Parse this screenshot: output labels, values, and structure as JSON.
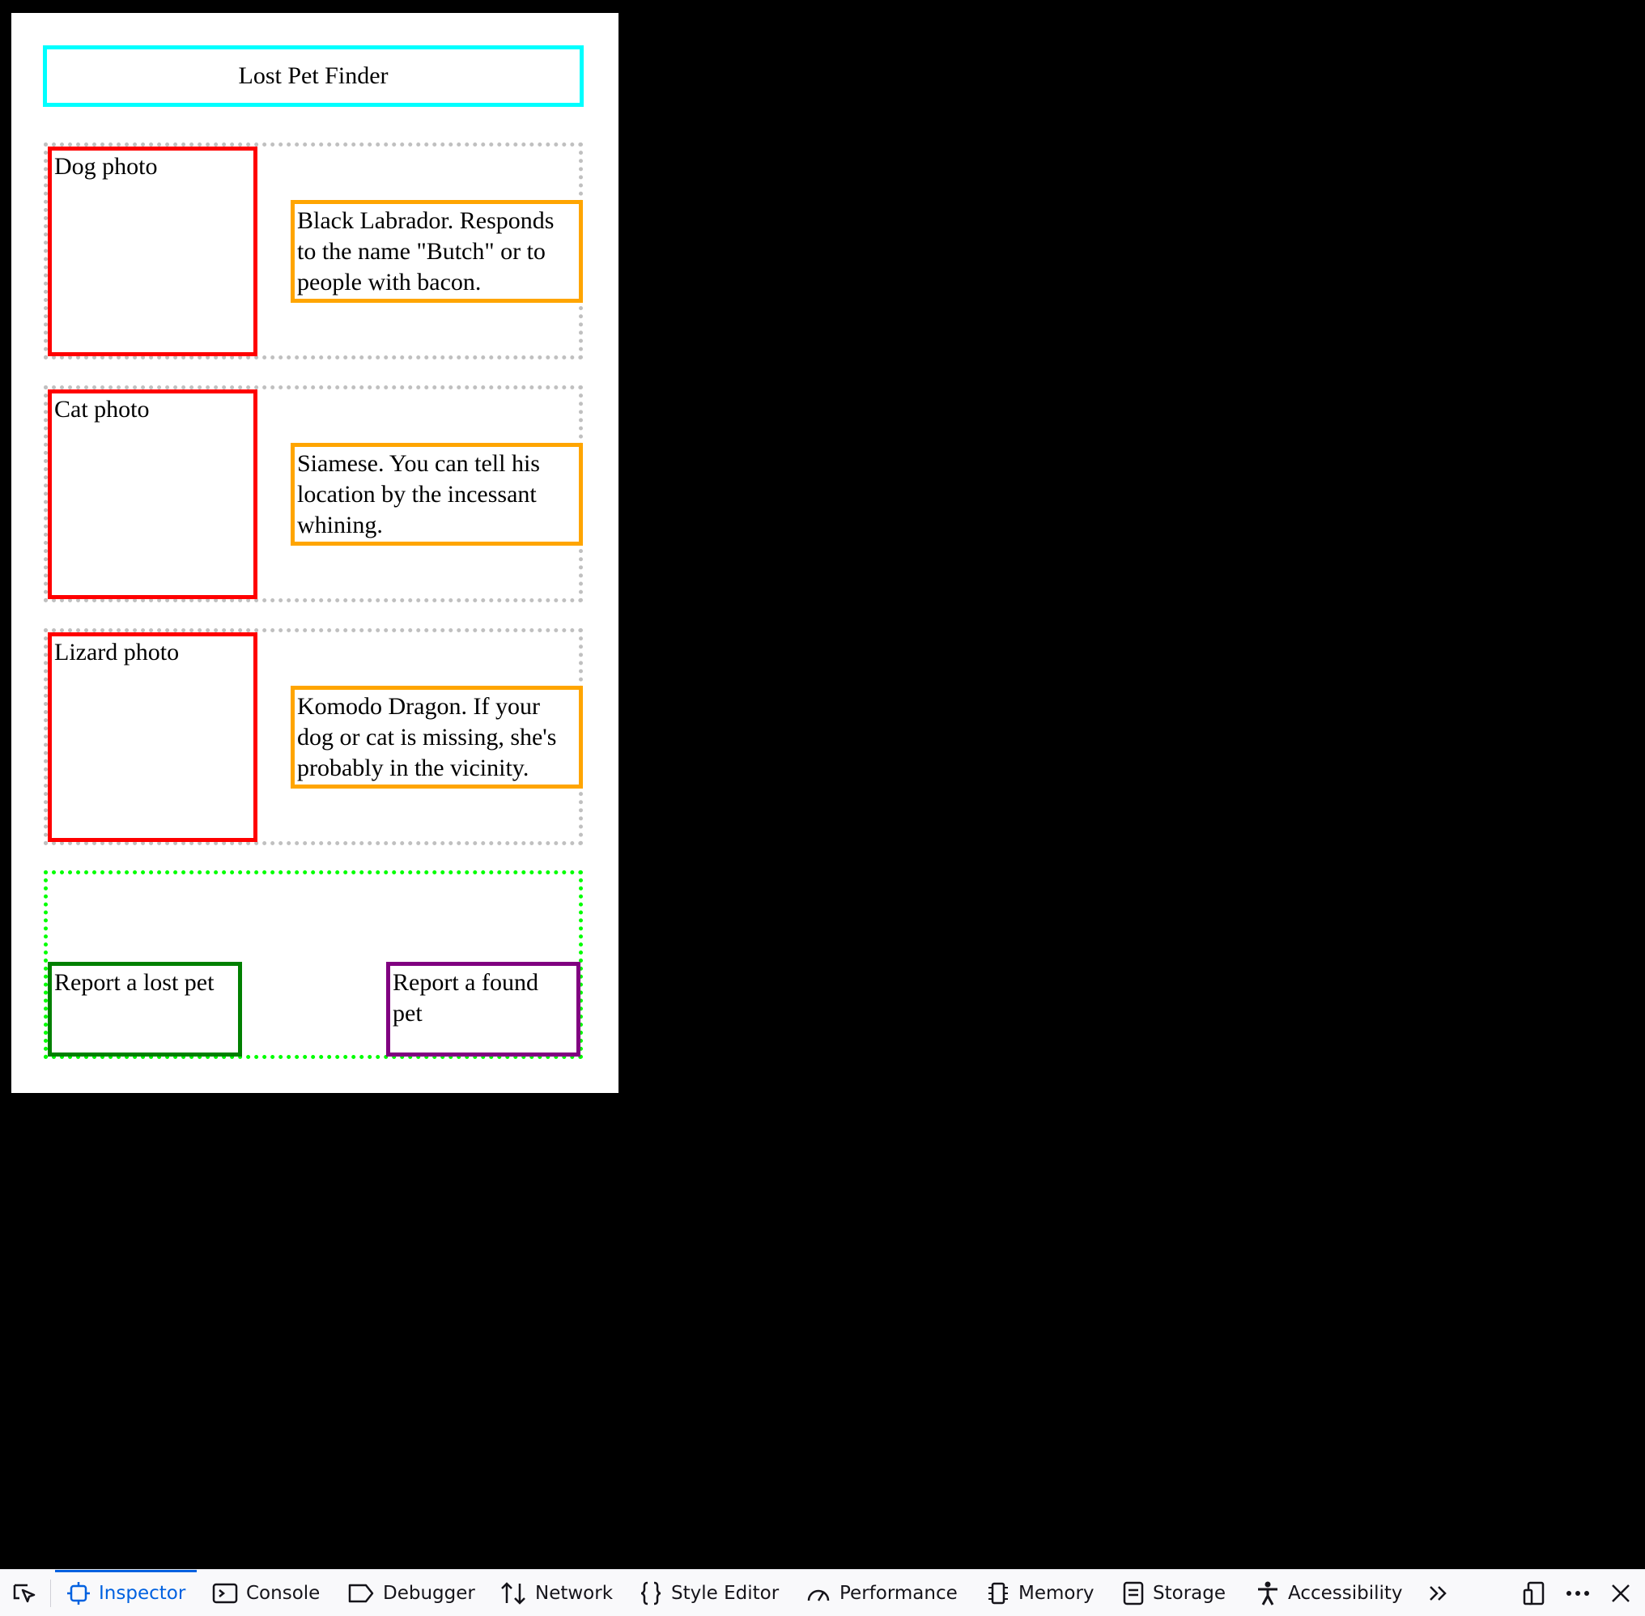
{
  "page": {
    "header_title": "Lost Pet Finder",
    "pets": [
      {
        "photo_label": "Dog photo",
        "description": "Black Labrador. Responds to the name \"Butch\" or to people with bacon."
      },
      {
        "photo_label": "Cat photo",
        "description": "Siamese. You can tell his location by the incessant whining."
      },
      {
        "photo_label": "Lizard photo",
        "description": "Komodo Dragon. If your dog or cat is missing, she's probably in the vicinity."
      }
    ],
    "actions": {
      "report_lost": "Report a lost pet",
      "report_found": "Report a found pet"
    }
  },
  "devtools": {
    "tabs": [
      {
        "label": "Inspector",
        "icon": "inspector-icon",
        "active": true
      },
      {
        "label": "Console",
        "icon": "console-icon"
      },
      {
        "label": "Debugger",
        "icon": "debugger-icon"
      },
      {
        "label": "Network",
        "icon": "network-icon"
      },
      {
        "label": "Style Editor",
        "icon": "style-editor-icon"
      },
      {
        "label": "Performance",
        "icon": "performance-icon"
      },
      {
        "label": "Memory",
        "icon": "memory-icon"
      },
      {
        "label": "Storage",
        "icon": "storage-icon"
      },
      {
        "label": "Accessibility",
        "icon": "accessibility-icon"
      }
    ],
    "accent_color": "#0061e0"
  },
  "colors": {
    "header_border": "#00ffff",
    "photo_border": "#ff0000",
    "description_border": "#ffa500",
    "row_border": "#c0c0c0",
    "actions_border": "#00ff00",
    "lost_button_border": "#008000",
    "found_button_border": "#800080"
  }
}
